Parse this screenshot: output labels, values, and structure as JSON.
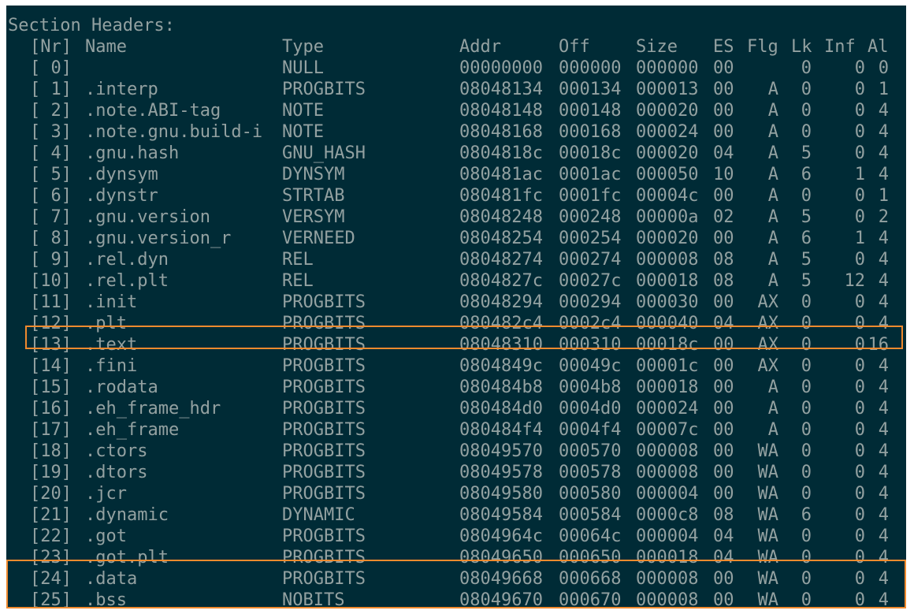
{
  "terminal": {
    "section_title": "Section Headers:",
    "headers": {
      "nr": "[Nr]",
      "name": "Name",
      "type": "Type",
      "addr": "Addr",
      "off": "Off",
      "size": "Size",
      "es": "ES",
      "flg": "Flg",
      "lk": "Lk",
      "inf": "Inf",
      "al": "Al"
    },
    "rows": [
      {
        "nr": "[ 0]",
        "name": "",
        "type": "NULL",
        "addr": "00000000",
        "off": "000000",
        "size": "000000",
        "es": "00",
        "flg": "",
        "lk": "0",
        "inf": "0",
        "al": "0"
      },
      {
        "nr": "[ 1]",
        "name": ".interp",
        "type": "PROGBITS",
        "addr": "08048134",
        "off": "000134",
        "size": "000013",
        "es": "00",
        "flg": "A",
        "lk": "0",
        "inf": "0",
        "al": "1"
      },
      {
        "nr": "[ 2]",
        "name": ".note.ABI-tag",
        "type": "NOTE",
        "addr": "08048148",
        "off": "000148",
        "size": "000020",
        "es": "00",
        "flg": "A",
        "lk": "0",
        "inf": "0",
        "al": "4"
      },
      {
        "nr": "[ 3]",
        "name": ".note.gnu.build-i",
        "type": "NOTE",
        "addr": "08048168",
        "off": "000168",
        "size": "000024",
        "es": "00",
        "flg": "A",
        "lk": "0",
        "inf": "0",
        "al": "4"
      },
      {
        "nr": "[ 4]",
        "name": ".gnu.hash",
        "type": "GNU_HASH",
        "addr": "0804818c",
        "off": "00018c",
        "size": "000020",
        "es": "04",
        "flg": "A",
        "lk": "5",
        "inf": "0",
        "al": "4"
      },
      {
        "nr": "[ 5]",
        "name": ".dynsym",
        "type": "DYNSYM",
        "addr": "080481ac",
        "off": "0001ac",
        "size": "000050",
        "es": "10",
        "flg": "A",
        "lk": "6",
        "inf": "1",
        "al": "4"
      },
      {
        "nr": "[ 6]",
        "name": ".dynstr",
        "type": "STRTAB",
        "addr": "080481fc",
        "off": "0001fc",
        "size": "00004c",
        "es": "00",
        "flg": "A",
        "lk": "0",
        "inf": "0",
        "al": "1"
      },
      {
        "nr": "[ 7]",
        "name": ".gnu.version",
        "type": "VERSYM",
        "addr": "08048248",
        "off": "000248",
        "size": "00000a",
        "es": "02",
        "flg": "A",
        "lk": "5",
        "inf": "0",
        "al": "2"
      },
      {
        "nr": "[ 8]",
        "name": ".gnu.version_r",
        "type": "VERNEED",
        "addr": "08048254",
        "off": "000254",
        "size": "000020",
        "es": "00",
        "flg": "A",
        "lk": "6",
        "inf": "1",
        "al": "4"
      },
      {
        "nr": "[ 9]",
        "name": ".rel.dyn",
        "type": "REL",
        "addr": "08048274",
        "off": "000274",
        "size": "000008",
        "es": "08",
        "flg": "A",
        "lk": "5",
        "inf": "0",
        "al": "4"
      },
      {
        "nr": "[10]",
        "name": ".rel.plt",
        "type": "REL",
        "addr": "0804827c",
        "off": "00027c",
        "size": "000018",
        "es": "08",
        "flg": "A",
        "lk": "5",
        "inf": "12",
        "al": "4"
      },
      {
        "nr": "[11]",
        "name": ".init",
        "type": "PROGBITS",
        "addr": "08048294",
        "off": "000294",
        "size": "000030",
        "es": "00",
        "flg": "AX",
        "lk": "0",
        "inf": "0",
        "al": "4"
      },
      {
        "nr": "[12]",
        "name": ".plt",
        "type": "PROGBITS",
        "addr": "080482c4",
        "off": "0002c4",
        "size": "000040",
        "es": "04",
        "flg": "AX",
        "lk": "0",
        "inf": "0",
        "al": "4"
      },
      {
        "nr": "[13]",
        "name": ".text",
        "type": "PROGBITS",
        "addr": "08048310",
        "off": "000310",
        "size": "00018c",
        "es": "00",
        "flg": "AX",
        "lk": "0",
        "inf": "0",
        "al": "16"
      },
      {
        "nr": "[14]",
        "name": ".fini",
        "type": "PROGBITS",
        "addr": "0804849c",
        "off": "00049c",
        "size": "00001c",
        "es": "00",
        "flg": "AX",
        "lk": "0",
        "inf": "0",
        "al": "4"
      },
      {
        "nr": "[15]",
        "name": ".rodata",
        "type": "PROGBITS",
        "addr": "080484b8",
        "off": "0004b8",
        "size": "000018",
        "es": "00",
        "flg": "A",
        "lk": "0",
        "inf": "0",
        "al": "4"
      },
      {
        "nr": "[16]",
        "name": ".eh_frame_hdr",
        "type": "PROGBITS",
        "addr": "080484d0",
        "off": "0004d0",
        "size": "000024",
        "es": "00",
        "flg": "A",
        "lk": "0",
        "inf": "0",
        "al": "4"
      },
      {
        "nr": "[17]",
        "name": ".eh_frame",
        "type": "PROGBITS",
        "addr": "080484f4",
        "off": "0004f4",
        "size": "00007c",
        "es": "00",
        "flg": "A",
        "lk": "0",
        "inf": "0",
        "al": "4"
      },
      {
        "nr": "[18]",
        "name": ".ctors",
        "type": "PROGBITS",
        "addr": "08049570",
        "off": "000570",
        "size": "000008",
        "es": "00",
        "flg": "WA",
        "lk": "0",
        "inf": "0",
        "al": "4"
      },
      {
        "nr": "[19]",
        "name": ".dtors",
        "type": "PROGBITS",
        "addr": "08049578",
        "off": "000578",
        "size": "000008",
        "es": "00",
        "flg": "WA",
        "lk": "0",
        "inf": "0",
        "al": "4"
      },
      {
        "nr": "[20]",
        "name": ".jcr",
        "type": "PROGBITS",
        "addr": "08049580",
        "off": "000580",
        "size": "000004",
        "es": "00",
        "flg": "WA",
        "lk": "0",
        "inf": "0",
        "al": "4"
      },
      {
        "nr": "[21]",
        "name": ".dynamic",
        "type": "DYNAMIC",
        "addr": "08049584",
        "off": "000584",
        "size": "0000c8",
        "es": "08",
        "flg": "WA",
        "lk": "6",
        "inf": "0",
        "al": "4"
      },
      {
        "nr": "[22]",
        "name": ".got",
        "type": "PROGBITS",
        "addr": "0804964c",
        "off": "00064c",
        "size": "000004",
        "es": "04",
        "flg": "WA",
        "lk": "0",
        "inf": "0",
        "al": "4"
      },
      {
        "nr": "[23]",
        "name": ".got.plt",
        "type": "PROGBITS",
        "addr": "08049650",
        "off": "000650",
        "size": "000018",
        "es": "04",
        "flg": "WA",
        "lk": "0",
        "inf": "0",
        "al": "4"
      },
      {
        "nr": "[24]",
        "name": ".data",
        "type": "PROGBITS",
        "addr": "08049668",
        "off": "000668",
        "size": "000008",
        "es": "00",
        "flg": "WA",
        "lk": "0",
        "inf": "0",
        "al": "4"
      },
      {
        "nr": "[25]",
        "name": ".bss",
        "type": "NOBITS",
        "addr": "08049670",
        "off": "000670",
        "size": "000008",
        "es": "00",
        "flg": "WA",
        "lk": "0",
        "inf": "0",
        "al": "4"
      }
    ]
  },
  "colors": {
    "background": "#002b36",
    "text": "#93a1a1",
    "highlight_box": "#f08a2e"
  }
}
